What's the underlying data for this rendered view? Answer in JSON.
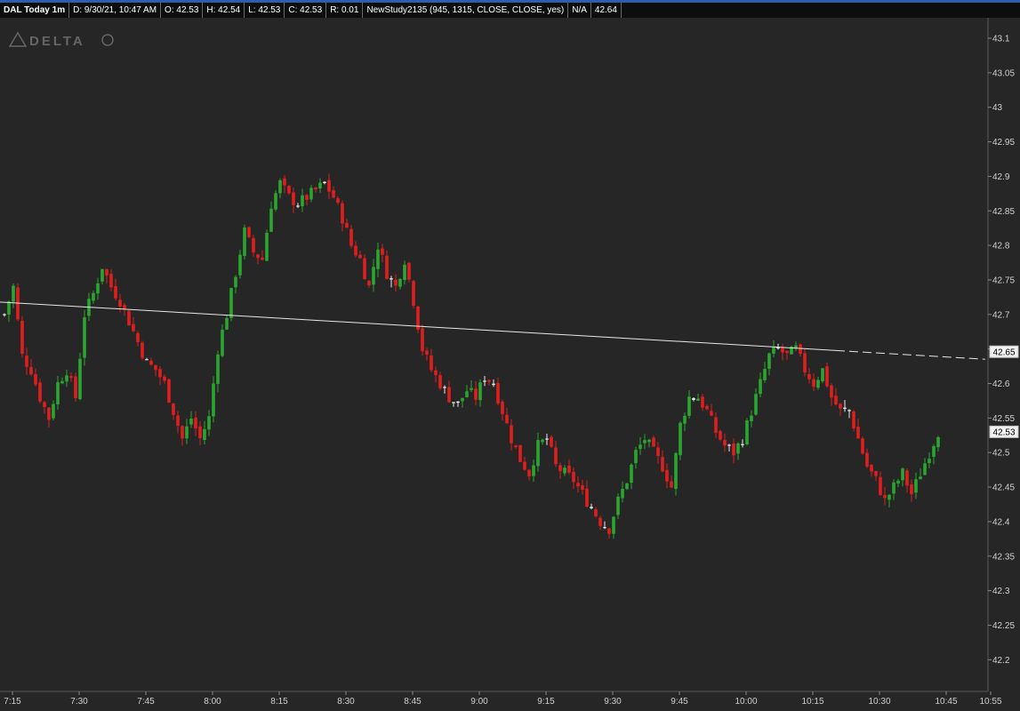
{
  "header": {
    "symbol": "DAL Today 1m",
    "date_time": "D: 9/30/21, 10:47 AM",
    "open": "O: 42.53",
    "high": "H: 42.54",
    "low": "L: 42.53",
    "close": "C: 42.53",
    "range": "R: 0.01",
    "study": "NewStudy2135 (945, 1315, CLOSE, CLOSE, yes)",
    "study_value_label": "N/A",
    "study_value": "42.64"
  },
  "logo": {
    "text": "DELTA"
  },
  "colors": {
    "background": "#262626",
    "up": "#2aa52f",
    "down": "#e01e1e",
    "neutral": "#e8e8e8",
    "trendline": "#e8e8e8",
    "text": "#ffffff",
    "axis_text": "#d0d0d0"
  },
  "chart_data": {
    "type": "candlestick",
    "title": "",
    "xlabel": "",
    "ylabel": "",
    "ylim": [
      42.155,
      43.13
    ],
    "xlim": [
      "7:15",
      "10:55"
    ],
    "y_ticks": [
      "43.1",
      "43.05",
      "43",
      "42.95",
      "42.9",
      "42.85",
      "42.8",
      "42.75",
      "42.7",
      "42.65",
      "42.6",
      "42.55",
      "42.5",
      "42.45",
      "42.4",
      "42.35",
      "42.3",
      "42.25",
      "42.2"
    ],
    "y_tick_values": [
      43.1,
      43.05,
      43.0,
      42.95,
      42.9,
      42.85,
      42.8,
      42.75,
      42.7,
      42.65,
      42.6,
      42.55,
      42.5,
      42.45,
      42.4,
      42.35,
      42.3,
      42.25,
      42.2
    ],
    "x_ticks": [
      "7:15",
      "7:30",
      "7:45",
      "8:00",
      "8:15",
      "8:30",
      "8:45",
      "9:00",
      "9:15",
      "9:30",
      "9:45",
      "10:00",
      "10:15",
      "10:30",
      "10:45",
      "10:55"
    ],
    "x_tick_minutes": [
      0,
      15,
      30,
      45,
      60,
      75,
      90,
      105,
      120,
      135,
      150,
      165,
      180,
      195,
      210,
      220
    ],
    "price_labels": [
      {
        "text": "42.65",
        "value": 42.646
      },
      {
        "text": "42.53",
        "value": 42.53
      }
    ],
    "trendline": {
      "start_value": 42.718,
      "solid_end_minute": 187,
      "end_minute": 221,
      "end_value": 42.635
    },
    "anchors": [
      [
        0,
        42.7
      ],
      [
        2,
        42.74
      ],
      [
        4,
        42.64
      ],
      [
        6,
        42.62
      ],
      [
        8,
        42.58
      ],
      [
        10,
        42.55
      ],
      [
        12,
        42.6
      ],
      [
        14,
        42.62
      ],
      [
        16,
        42.58
      ],
      [
        18,
        42.7
      ],
      [
        20,
        42.73
      ],
      [
        22,
        42.77
      ],
      [
        24,
        42.74
      ],
      [
        26,
        42.72
      ],
      [
        28,
        42.69
      ],
      [
        30,
        42.66
      ],
      [
        32,
        42.63
      ],
      [
        34,
        42.62
      ],
      [
        36,
        42.6
      ],
      [
        38,
        42.56
      ],
      [
        40,
        42.52
      ],
      [
        42,
        42.55
      ],
      [
        44,
        42.52
      ],
      [
        46,
        42.55
      ],
      [
        48,
        42.65
      ],
      [
        50,
        42.7
      ],
      [
        52,
        42.76
      ],
      [
        54,
        42.82
      ],
      [
        56,
        42.79
      ],
      [
        58,
        42.78
      ],
      [
        60,
        42.86
      ],
      [
        62,
        42.89
      ],
      [
        64,
        42.87
      ],
      [
        66,
        42.86
      ],
      [
        68,
        42.87
      ],
      [
        70,
        42.88
      ],
      [
        72,
        42.89
      ],
      [
        74,
        42.87
      ],
      [
        76,
        42.84
      ],
      [
        78,
        42.8
      ],
      [
        80,
        42.78
      ],
      [
        82,
        42.74
      ],
      [
        84,
        42.8
      ],
      [
        86,
        42.76
      ],
      [
        88,
        42.74
      ],
      [
        90,
        42.78
      ],
      [
        92,
        42.72
      ],
      [
        94,
        42.65
      ],
      [
        96,
        42.62
      ],
      [
        98,
        42.6
      ],
      [
        100,
        42.58
      ],
      [
        102,
        42.57
      ],
      [
        104,
        42.59
      ],
      [
        106,
        42.58
      ],
      [
        108,
        42.61
      ],
      [
        110,
        42.6
      ],
      [
        112,
        42.56
      ],
      [
        114,
        42.52
      ],
      [
        116,
        42.49
      ],
      [
        118,
        42.47
      ],
      [
        120,
        42.51
      ],
      [
        122,
        42.52
      ],
      [
        124,
        42.48
      ],
      [
        126,
        42.47
      ],
      [
        128,
        42.46
      ],
      [
        130,
        42.44
      ],
      [
        132,
        42.42
      ],
      [
        134,
        42.4
      ],
      [
        136,
        42.39
      ],
      [
        138,
        42.43
      ],
      [
        140,
        42.46
      ],
      [
        142,
        42.5
      ],
      [
        144,
        42.52
      ],
      [
        146,
        42.5
      ],
      [
        148,
        42.48
      ],
      [
        150,
        42.45
      ],
      [
        152,
        42.54
      ],
      [
        154,
        42.58
      ],
      [
        156,
        42.58
      ],
      [
        158,
        42.56
      ],
      [
        160,
        42.53
      ],
      [
        162,
        42.51
      ],
      [
        164,
        42.5
      ],
      [
        166,
        42.52
      ],
      [
        168,
        42.56
      ],
      [
        170,
        42.6
      ],
      [
        172,
        42.64
      ],
      [
        174,
        42.65
      ],
      [
        176,
        42.64
      ],
      [
        178,
        42.65
      ],
      [
        180,
        42.62
      ],
      [
        182,
        42.6
      ],
      [
        184,
        42.62
      ],
      [
        186,
        42.58
      ],
      [
        188,
        42.56
      ],
      [
        190,
        42.56
      ],
      [
        192,
        42.52
      ],
      [
        194,
        42.48
      ],
      [
        196,
        42.46
      ],
      [
        198,
        42.43
      ],
      [
        200,
        42.45
      ],
      [
        202,
        42.47
      ],
      [
        204,
        42.44
      ],
      [
        206,
        42.47
      ],
      [
        208,
        42.5
      ],
      [
        210,
        42.53
      ]
    ]
  }
}
